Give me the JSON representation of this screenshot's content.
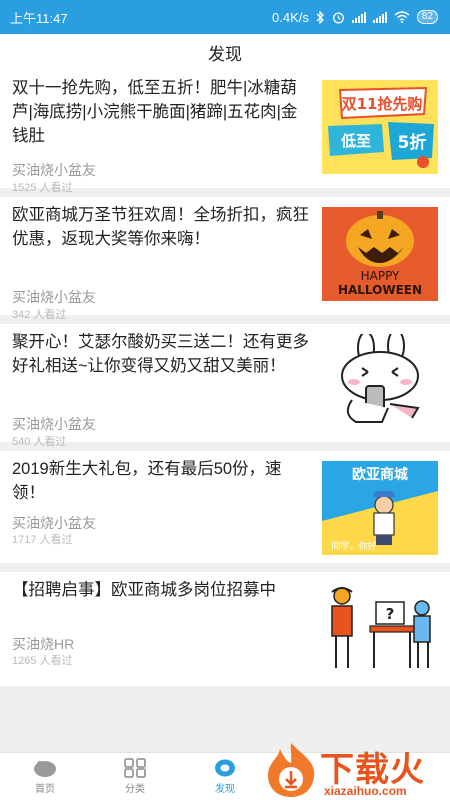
{
  "status_bar": {
    "time": "上午11:47",
    "network_speed": "0.4K/s",
    "battery": "82",
    "icons": [
      "bluetooth-icon",
      "alarm-icon",
      "signal-icon",
      "wifi-icon",
      "battery-icon"
    ]
  },
  "header": {
    "title": "发现"
  },
  "feed": {
    "items": [
      {
        "title": "双十一抢先购，低至五折！肥牛|冰糖葫芦|海底捞|小浣熊干脆面|猪蹄|五花肉|金钱肚",
        "author": "买油烧小盆友",
        "views": "1525 人看过",
        "thumb_text": [
          "双11抢先购",
          "低至",
          "5折"
        ]
      },
      {
        "title": "欧亚商城万圣节狂欢周！全场折扣，疯狂优惠，返现大奖等你来嗨！",
        "author": "买油烧小盆友",
        "views": "342 人看过",
        "thumb_text": [
          "HAPPY",
          "HALLOWEEN"
        ]
      },
      {
        "title": "聚开心！艾瑟尔酸奶买三送二！还有更多好礼相送~让你变得又奶又甜又美丽！",
        "author": "买油烧小盆友",
        "views": "540 人看过"
      },
      {
        "title": "2019新生大礼包，还有最后50份，速领！",
        "author": "买油烧小盆友",
        "views": "1717 人看过",
        "thumb_text": [
          "欧亚商城",
          "同学，你好"
        ]
      },
      {
        "title": "【招聘启事】欧亚商城多岗位招募中",
        "author": "买油烧HR",
        "views": "1265 人看过"
      }
    ]
  },
  "tabbar": {
    "items": [
      {
        "label": "首页",
        "icon": "home-icon"
      },
      {
        "label": "分类",
        "icon": "grid-icon"
      },
      {
        "label": "发现",
        "icon": "discover-icon",
        "active": true
      }
    ]
  },
  "watermark": {
    "text": "下载火",
    "url": "xiazaihuo.com"
  },
  "colors": {
    "accent": "#2a9ee0",
    "watermark": "#e8541e"
  }
}
